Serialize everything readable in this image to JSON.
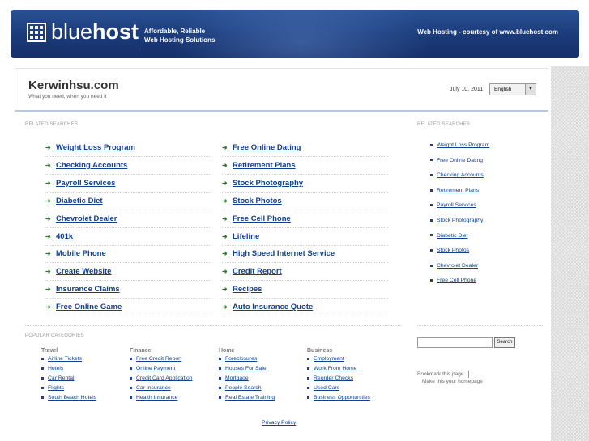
{
  "banner": {
    "logo_regular": "blue",
    "logo_bold": "host",
    "tagline_line1": "Affordable, Reliable",
    "tagline_line2": "Web Hosting Solutions",
    "courtesy": "Web Hosting - courtesy of www.bluehost.com"
  },
  "site": {
    "title": "Kerwinhsu.com",
    "subtitle": "What you need, when you need it",
    "date": "July 10, 2011",
    "language": "English"
  },
  "related_label": "RELATED SEARCHES",
  "side_related_label": "RELATED SEARCHES",
  "main_links": [
    "Weight Loss Program",
    "Free Online Dating",
    "Checking Accounts",
    "Retirement Plans",
    "Payroll Services",
    "Stock Photography",
    "Diabetic Diet",
    "Stock Photos",
    "Chevrolet Dealer",
    "Free Cell Phone",
    "401k",
    "Lifeline",
    "Mobile Phone",
    "High Speed Internet Service",
    "Create Website",
    "Credit Report",
    "Insurance Claims",
    "Recipes",
    "Free Online Game",
    "Auto Insurance Quote"
  ],
  "side_links": [
    "Weight Loss Program",
    "Free Online Dating",
    "Checking Accounts",
    "Retirement Plans",
    "Payroll Services",
    "Stock Photography",
    "Diabetic Diet",
    "Stock Photos",
    "Chevrolet Dealer",
    "Free Cell Phone"
  ],
  "popular_label": "POPULAR CATEGORIES",
  "categories": [
    {
      "name": "Travel",
      "items": [
        "Airline Tickets",
        "Hotels",
        "Car Rental",
        "Flights",
        "South Beach Hotels"
      ]
    },
    {
      "name": "Finance",
      "items": [
        "Free Credit Report",
        "Online Payment",
        "Credit Card Application",
        "Car Insurance",
        "Health Insurance"
      ]
    },
    {
      "name": "Home",
      "items": [
        "Foreclosures",
        "Houses For Sale",
        "Mortgage",
        "People Search",
        "Real Estate Training"
      ]
    },
    {
      "name": "Business",
      "items": [
        "Employment",
        "Work From Home",
        "Reorder Checks",
        "Used Cars",
        "Business Opportunities"
      ]
    }
  ],
  "search": {
    "button": "Search",
    "value": ""
  },
  "bookmark": "Bookmark this page",
  "homepage": "Make this your homepage",
  "privacy": "Privacy Policy",
  "icons": {
    "arrow": "arrow-right-icon",
    "bullet": "bullet-icon",
    "logo": "bluehost-grid-logo-icon",
    "dropdown": "chevron-down-icon"
  }
}
